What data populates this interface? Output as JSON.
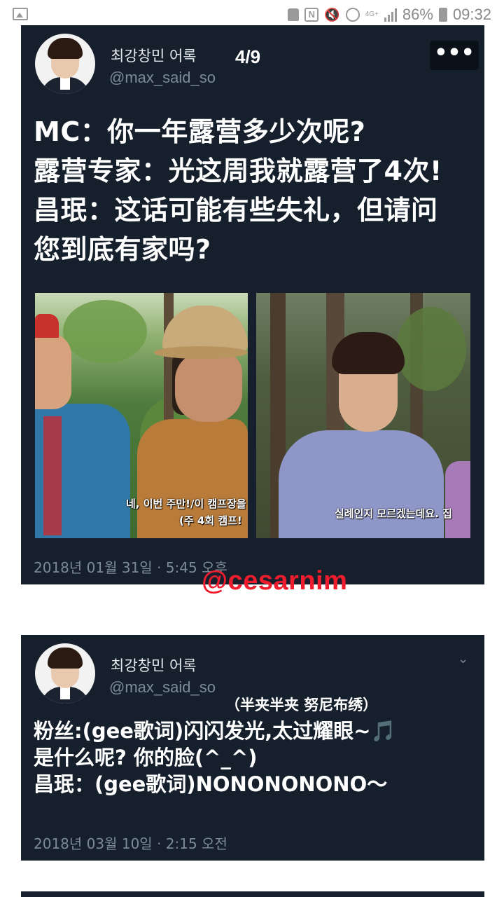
{
  "status_bar": {
    "battery": "86%",
    "time": "09:32",
    "network": "4G+",
    "icons": [
      "image-icon",
      "nfc-icon",
      "mute-icon",
      "alarm-icon",
      "signal-icon",
      "battery-icon"
    ]
  },
  "tweets": [
    {
      "author_name": "최강창민 어록",
      "author_handle": "@max_said_so",
      "page_indicator": "4/9",
      "more_label": "•••",
      "lines": [
        "MC：你一年露营多少次呢?",
        "露营专家：光这周我就露营了4次!",
        "昌珉：这话可能有些失礼，但请问",
        "您到底有家吗?"
      ],
      "image_left_subtitles": [
        "네, 이번 주만!/이 캠프장을 포함",
        "(주 4회 캠프!"
      ],
      "image_right_subtitle": "실례인지 모르겠는데요. 집",
      "timestamp": "2018년 01월 31일 · 5:45 오후"
    },
    {
      "author_name": "최강창민 어록",
      "author_handle": "@max_said_so",
      "translator_note": "（半夹半夹 努尼布绣）",
      "lines": [
        "粉丝:(gee歌词)闪闪发光,太过耀眼~🎵",
        "是什么呢? 你的脸(^_^)",
        "昌珉：(gee歌词)NONONONONO～"
      ],
      "timestamp": "2018년 03월 10일 · 2:15 오전"
    }
  ],
  "watermark": "@cesarnim",
  "colors": {
    "card_bg": "#16202c",
    "muted": "#7e8a96",
    "watermark": "#ee1c2c"
  }
}
